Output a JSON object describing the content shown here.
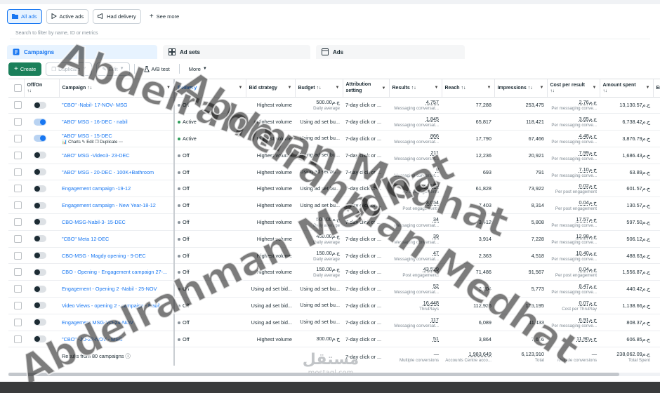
{
  "view_filters": {
    "all_ads": "All ads",
    "active_ads": "Active ads",
    "had_delivery": "Had delivery",
    "see_more": "See more"
  },
  "search": {
    "placeholder": "Search to filter by name, ID or metrics"
  },
  "tabs": {
    "campaigns": "Campaigns",
    "ad_sets": "Ad sets",
    "ads": "Ads"
  },
  "toolbar": {
    "create": "Create",
    "duplicate": "Duplicate",
    "edit": "Edit",
    "ab_test": "A/B test",
    "more": "More"
  },
  "columns": {
    "off_on": "Off/On",
    "campaign": "Campaign",
    "delivery": "Delivery",
    "bid_strategy": "Bid strategy",
    "budget": "Budget",
    "attribution": "Attribution setting",
    "results": "Results",
    "reach": "Reach",
    "impressions": "Impressions",
    "cost_per_result": "Cost per result",
    "amount_spent": "Amount spent",
    "ends": "En"
  },
  "row_actions": {
    "charts": "Charts",
    "edit": "Edit",
    "duplicate": "Duplicate"
  },
  "rows": [
    {
      "on": false,
      "name": "\"CBO\" -Nabil- 17-NOV- MSG",
      "delivery": "Off",
      "bid": "Highest volume",
      "budget": "500.00ج.م",
      "budget_sub": "Daily average",
      "attr": "7-day click or ...",
      "results": "4,757",
      "results_sub": "Messaging conversat...",
      "reach": "77,288",
      "impr": "253,475",
      "cpr": "2.76ج.م",
      "cpr_sub": "Per messaging conve...",
      "spent": "13,130.57ج.م"
    },
    {
      "on": true,
      "name": "\"ABO\" MSG - 16-DEC - nabil",
      "delivery": "Active",
      "bid": "Highest volume",
      "budget": "Using ad set bu...",
      "budget_sub": "",
      "attr": "7-day click or ...",
      "results": "1,845",
      "results_sub": "Messaging conversat...",
      "reach": "65,817",
      "impr": "118,421",
      "cpr": "3.65ج.م",
      "cpr_sub": "Per messaging conve...",
      "spent": "6,738.42ج.م"
    },
    {
      "on": true,
      "name": "\"ABO\" MSG - 15-DEC",
      "delivery": "Active",
      "bid": "Highest volume",
      "budget": "Using ad set bu...",
      "budget_sub": "",
      "attr": "7-day click or ...",
      "results": "866",
      "results_sub": "Messaging conversat...",
      "reach": "17,790",
      "impr": "67,466",
      "cpr": "4.48ج.م",
      "cpr_sub": "Per messaging conve...",
      "spent": "3,876.79ج.م",
      "actions": true
    },
    {
      "on": false,
      "name": "\"ABO\" MSG -Video3- 23-DEC",
      "delivery": "Off",
      "bid": "Highest volume",
      "budget": "Using ad set bu...",
      "budget_sub": "",
      "attr": "7-day click or ...",
      "results": "211",
      "results_sub": "Messaging conversat...",
      "reach": "12,236",
      "impr": "20,921",
      "cpr": "7.99ج.م",
      "cpr_sub": "Per messaging conve...",
      "spent": "1,686.43ج.م"
    },
    {
      "on": false,
      "name": "\"ABO\" MSG - 20-DEC - 100K+Bathroom",
      "delivery": "Off",
      "bid": "Highest volume",
      "budget": "Using ad set bu...",
      "budget_sub": "",
      "attr": "7-day click or ...",
      "results": "9",
      "results_sub": "Messaging conversat...",
      "reach": "693",
      "impr": "791",
      "cpr": "7.10ج.م",
      "cpr_sub": "Per messaging conve...",
      "spent": "63.89ج.م"
    },
    {
      "on": false,
      "name": "Engagement campaign -19-12",
      "delivery": "Off",
      "bid": "Highest volume",
      "budget": "Using ad set bu...",
      "budget_sub": "",
      "attr": "7-day click or ...",
      "results": "34,825",
      "results_sub": "Post engagements",
      "reach": "61,828",
      "impr": "73,922",
      "cpr": "0.02ج.م",
      "cpr_sub": "Per post engagement",
      "spent": "601.57ج.م"
    },
    {
      "on": false,
      "name": "Engagement campaign - New Year-18-12",
      "delivery": "Off",
      "bid": "Highest volume",
      "budget": "Using ad set bu...",
      "budget_sub": "",
      "attr": "7-day click or ...",
      "results": "3,054",
      "results_sub": "Post engagements",
      "reach": "7,403",
      "impr": "8,314",
      "cpr": "0.04ج.م",
      "cpr_sub": "Per post engagement",
      "spent": "130.57ج.م"
    },
    {
      "on": false,
      "name": "CBO-MSG-Nabil-3- 15-DEC",
      "delivery": "Off",
      "bid": "Highest volume",
      "budget": "500.00ج.م",
      "budget_sub": "Daily average",
      "attr": "7-day click or ...",
      "results": "34",
      "results_sub": "Messaging conversat...",
      "reach": "3,412",
      "impr": "5,808",
      "cpr": "17.57ج.م",
      "cpr_sub": "Per messaging conve...",
      "spent": "597.50ج.م"
    },
    {
      "on": false,
      "name": "\"CBO\" Meta 12-DEC",
      "delivery": "Off",
      "bid": "Highest volume",
      "budget": "400.00ج.م",
      "budget_sub": "Daily average",
      "attr": "7-day click or ...",
      "results": "39",
      "results_sub": "Messaging conversat...",
      "reach": "3,914",
      "impr": "7,228",
      "cpr": "12.98ج.م",
      "cpr_sub": "Per messaging conve...",
      "spent": "506.12ج.م"
    },
    {
      "on": false,
      "name": "CBO-MSG - Magdy opening - 9-DEC",
      "delivery": "Off",
      "bid": "Highest volume",
      "budget": "150.00ج.م",
      "budget_sub": "Daily average",
      "attr": "7-day click or ...",
      "results": "47",
      "results_sub": "Messaging conversat...",
      "reach": "2,363",
      "impr": "4,518",
      "cpr": "10.40ج.م",
      "cpr_sub": "Per messaging conve...",
      "spent": "488.63ج.م"
    },
    {
      "on": false,
      "name": "CBO - Opening - Engagement campaign 27-...",
      "delivery": "Off",
      "bid": "Highest volume",
      "budget": "150.00ج.م",
      "budget_sub": "Daily average",
      "attr": "7-day click or ...",
      "results": "43,529",
      "results_sub": "Post engagements",
      "reach": "71,486",
      "impr": "91,567",
      "cpr": "0.04ج.م",
      "cpr_sub": "Per post engagement",
      "spent": "1,556.87ج.م"
    },
    {
      "on": false,
      "name": "Engagement - Opening 2 -Nabil - 25-NOV",
      "delivery": "Off",
      "bid": "Using ad set bid...",
      "budget": "Using ad set bu...",
      "budget_sub": "",
      "attr": "7-day click or ...",
      "results": "52",
      "results_sub": "Messaging conversat...",
      "reach": "3,204",
      "impr": "5,773",
      "cpr": "8.47ج.م",
      "cpr_sub": "Per messaging conve...",
      "spent": "440.42ج.م"
    },
    {
      "on": false,
      "name": "Video Views - opening 2 - campaign - Nabil",
      "delivery": "Off",
      "bid": "Using ad set bid...",
      "budget": "Using ad set bu...",
      "budget_sub": "",
      "attr": "7-day click or ...",
      "results": "16,448",
      "results_sub": "ThruPlays",
      "reach": "112,926",
      "impr": "125,195",
      "cpr": "0.07ج.م",
      "cpr_sub": "Cost per ThruPlay",
      "spent": "1,138.66ج.م"
    },
    {
      "on": false,
      "name": "Engagement MSG-VO-24-NOV",
      "delivery": "Off",
      "bid": "Using ad set bid...",
      "budget": "Using ad set bu...",
      "budget_sub": "",
      "attr": "7-day click or ...",
      "results": "117",
      "results_sub": "Messaging conversat...",
      "reach": "6,089",
      "impr": "11,433",
      "cpr": "6.91ج.م",
      "cpr_sub": "Per messaging conve...",
      "spent": "808.37ج.م"
    },
    {
      "on": false,
      "name": "\"CBO\" -JO-22-NOV - MSG",
      "delivery": "Off",
      "bid": "Highest volume",
      "budget": "300.00ج.م",
      "budget_sub": "",
      "attr": "7-day click or ...",
      "results": "51",
      "results_sub": "",
      "reach": "3,864",
      "impr": "7,616",
      "cpr": "11.90ج.م",
      "cpr_sub": "",
      "spent": "606.85ج.م"
    }
  ],
  "footer": {
    "label": "Results from 80 campaigns",
    "attr": "7-day click or ...",
    "results": "—",
    "results_sub": "Multiple conversions",
    "reach": "1,983,649",
    "reach_sub": "Accounts Centre acco...",
    "impr": "6,123,910",
    "impr_sub": "Total",
    "cpr": "—",
    "cpr_sub": "Multiple conversions",
    "spent": "238,062.09ج.م",
    "spent_sub": "Total Spent"
  },
  "watermark": {
    "line1": "Abdelrahman Medhat",
    "line2": "Abdelrahman Medhat",
    "line3": "Abdelrahman Medhat"
  },
  "logo": {
    "arabic": "مستقل",
    "latin": "mostaql.com"
  },
  "colors": {
    "accent": "#1877f2",
    "create": "#1a7f5a",
    "active_dot": "#2e9e5b"
  }
}
